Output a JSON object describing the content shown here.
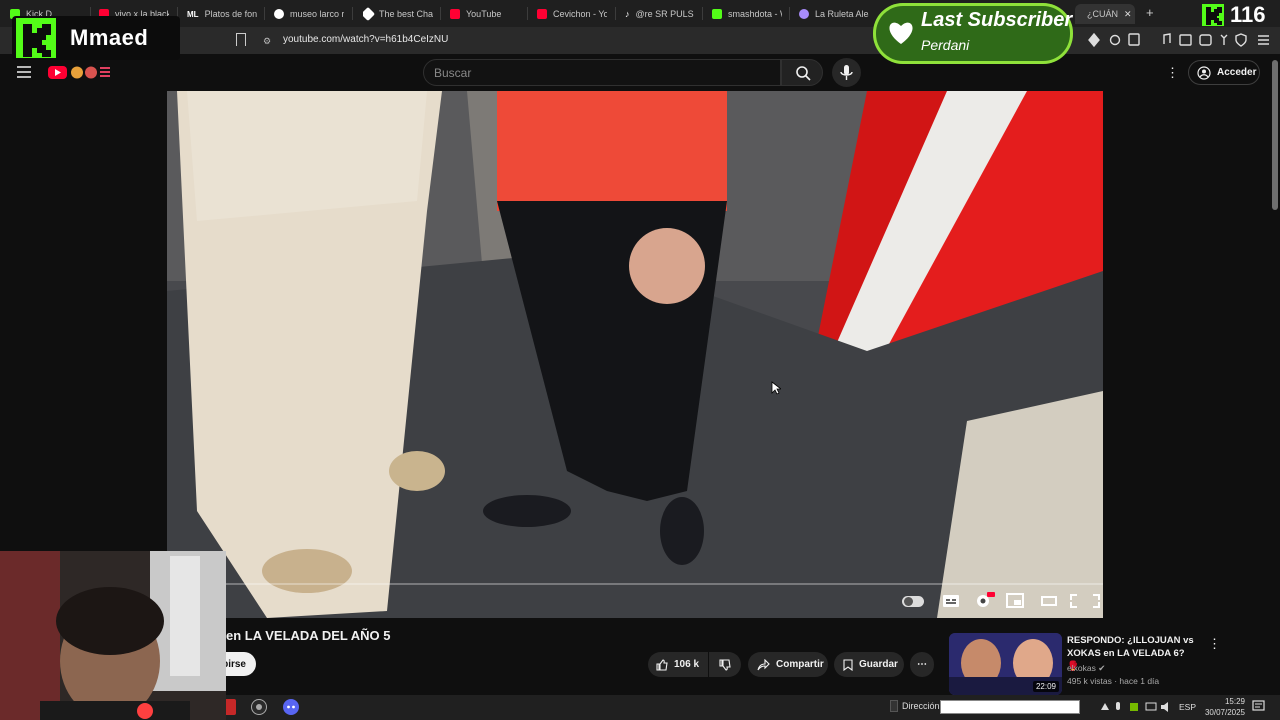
{
  "browser": {
    "tabs": [
      {
        "label": "Kick D",
        "color": "#53fc18"
      },
      {
        "label": "vivo x la blackli",
        "color": "#ff0033"
      },
      {
        "label": "Platos de fondo",
        "color": "#ffffff"
      },
      {
        "label": "museo larco re",
        "color": "#4285f4"
      },
      {
        "label": "The best ChatB",
        "color": "#ffffff"
      },
      {
        "label": "YouTube",
        "color": "#ff0033"
      },
      {
        "label": "Cevichon - You",
        "color": "#ff0033"
      },
      {
        "label": "@re SR PULS",
        "color": "#ffffff"
      },
      {
        "label": "smashdota - W",
        "color": "#53fc18"
      },
      {
        "label": "La Ruleta Aleat",
        "color": "#a78bfa"
      },
      {
        "label": "¿CUÁN",
        "color": "#ff0033"
      }
    ],
    "url": "youtube.com/watch?v=h61b4CeIzNU",
    "new_tab": "+"
  },
  "youtube": {
    "search_placeholder": "Buscar",
    "signin_label": "Acceder",
    "video_title": "en LA VELADA DEL AÑO 5",
    "subscribe_label": "birse",
    "likes": "106 k",
    "share_label": "Compartir",
    "save_label": "Guardar",
    "recommended": {
      "title": "RESPONDO: ¿ILLOJUAN vs XOKAS en LA VELADA 6? 🥊",
      "channel": "elxokas",
      "meta": "495 k vistas · hace 1 día",
      "duration": "22:09"
    }
  },
  "overlays": {
    "brand": "Mmaed",
    "last_subscriber_title": "Last Subscriber",
    "last_subscriber_name": "Perdani",
    "viewer_count": "116"
  },
  "taskbar": {
    "address_label": "Dirección",
    "language": "ESP",
    "time": "15:29",
    "date": "30/07/2025"
  },
  "colors": {
    "kick_green": "#53fc18",
    "youtube_red": "#ff0033",
    "background": "#0f0f0f"
  }
}
